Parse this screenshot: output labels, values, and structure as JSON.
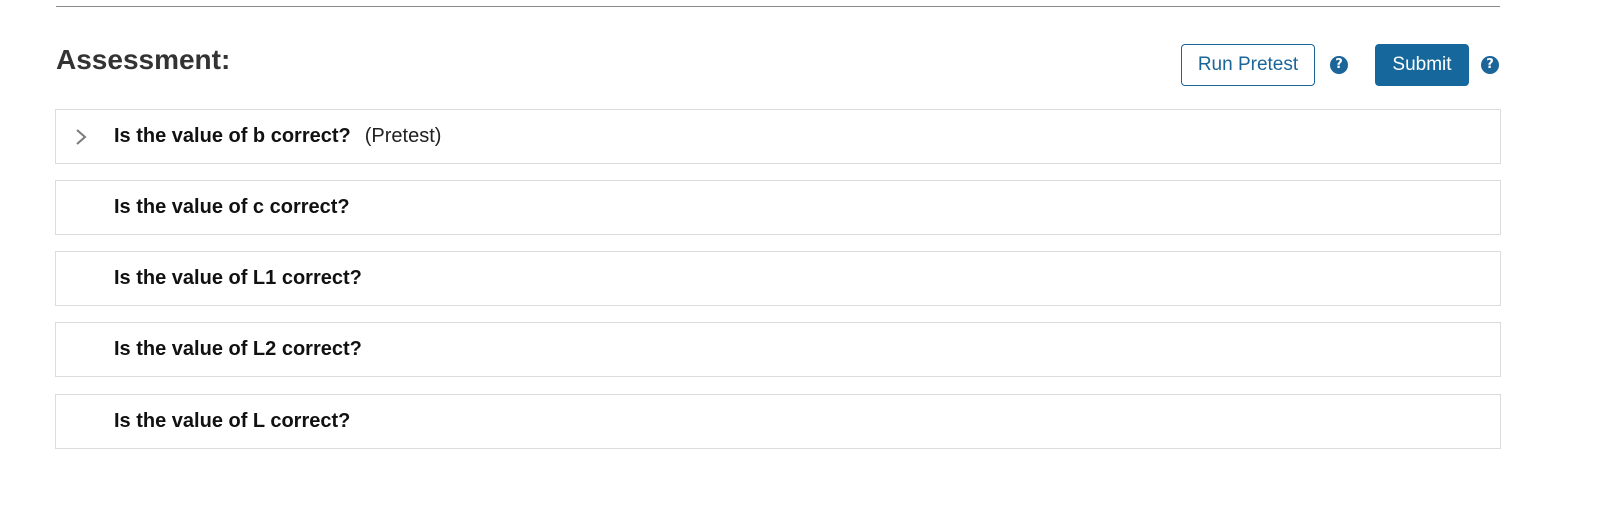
{
  "section": {
    "heading": "Assessment:"
  },
  "toolbar": {
    "run_pretest_label": "Run Pretest",
    "submit_label": "Submit",
    "help_glyph": "?",
    "icons": [
      "help-icon",
      "chevron-right-icon"
    ]
  },
  "questions": [
    {
      "text": "Is the value of b correct?",
      "note": "(Pretest)",
      "expandable": true
    },
    {
      "text": "Is the value of c correct?",
      "note": "",
      "expandable": false
    },
    {
      "text": "Is the value of L1 correct?",
      "note": "",
      "expandable": false
    },
    {
      "text": "Is the value of L2 correct?",
      "note": "",
      "expandable": false
    },
    {
      "text": "Is the value of L correct?",
      "note": "",
      "expandable": false
    }
  ],
  "colors": {
    "accent": "#16679c",
    "outline": "#1b6599",
    "border": "#dcdcdc",
    "heading": "#333333"
  }
}
